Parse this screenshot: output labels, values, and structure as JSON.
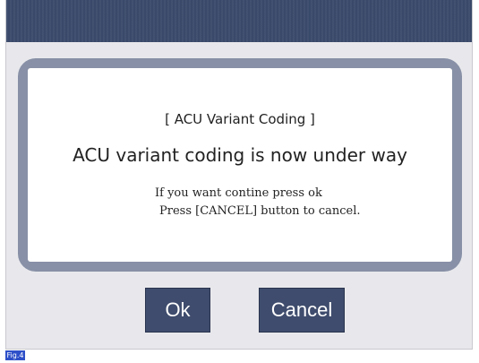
{
  "dialog": {
    "title": "[ ACU Variant Coding ]",
    "message": "ACU variant coding is now under way",
    "info_line_1": "If you want contine press ok",
    "info_line_2": "Press [CANCEL] button to cancel."
  },
  "buttons": {
    "ok_label": "Ok",
    "cancel_label": "Cancel"
  },
  "figure_label": "Fig.4",
  "colors": {
    "titlebar": "#3c4b6c",
    "dialog_border": "#8790a6",
    "button": "#3f4c6d",
    "figure_badge": "#2e50c8"
  }
}
